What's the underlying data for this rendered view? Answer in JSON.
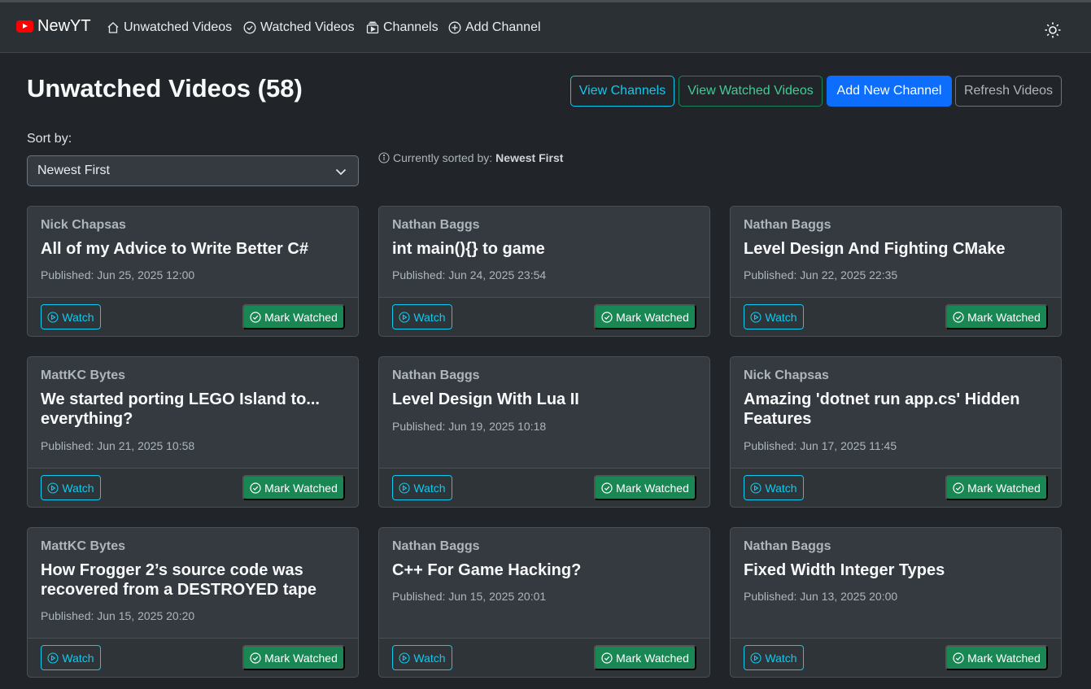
{
  "nav": {
    "brand": "NewYT",
    "links": [
      {
        "label": "Unwatched Videos",
        "icon": "house-icon"
      },
      {
        "label": "Watched Videos",
        "icon": "check-circle-icon"
      },
      {
        "label": "Channels",
        "icon": "collection-play-icon"
      },
      {
        "label": "Add Channel",
        "icon": "plus-circle-icon"
      }
    ],
    "theme_icon": "sun-icon"
  },
  "header": {
    "title": "Unwatched Videos (58)",
    "buttons": {
      "view_channels": "View Channels",
      "view_watched": "View Watched Videos",
      "add_channel": "Add New Channel",
      "refresh": "Refresh Videos"
    }
  },
  "sort": {
    "label": "Sort by:",
    "selected": "Newest First",
    "info_prefix": "Currently sorted by:",
    "info_value": "Newest First"
  },
  "videos": [
    {
      "channel": "Nick Chapsas",
      "title": "All of my Advice to Write Better C#",
      "published": "Published: Jun 25, 2025 12:00"
    },
    {
      "channel": "Nathan Baggs",
      "title": "int main(){} to game",
      "published": "Published: Jun 24, 2025 23:54"
    },
    {
      "channel": "Nathan Baggs",
      "title": "Level Design And Fighting CMake",
      "published": "Published: Jun 22, 2025 22:35"
    },
    {
      "channel": "MattKC Bytes",
      "title": "We started porting LEGO Island to... everything?",
      "published": "Published: Jun 21, 2025 10:58"
    },
    {
      "channel": "Nathan Baggs",
      "title": "Level Design With Lua II",
      "published": "Published: Jun 19, 2025 10:18"
    },
    {
      "channel": "Nick Chapsas",
      "title": "Amazing 'dotnet run app.cs' Hidden Features",
      "published": "Published: Jun 17, 2025 11:45"
    },
    {
      "channel": "MattKC Bytes",
      "title": "How Frogger 2’s source code was recovered from a DESTROYED tape",
      "published": "Published: Jun 15, 2025 20:20"
    },
    {
      "channel": "Nathan Baggs",
      "title": "C++ For Game Hacking?",
      "published": "Published: Jun 15, 2025 20:01"
    },
    {
      "channel": "Nathan Baggs",
      "title": "Fixed Width Integer Types",
      "published": "Published: Jun 13, 2025 20:00"
    }
  ],
  "card_actions": {
    "watch": "Watch",
    "mark_watched": "Mark Watched"
  },
  "colors": {
    "background": "#212529",
    "navbar": "#2b3035",
    "card": "#343a40",
    "info": "#0dcaf0",
    "primary": "#0d6efd",
    "success": "#198754",
    "brand_red": "#ff0000"
  }
}
